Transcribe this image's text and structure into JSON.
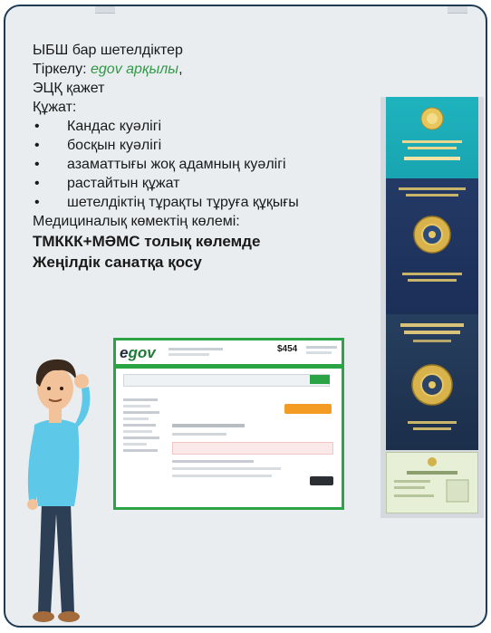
{
  "info": {
    "heading": "ЫБШ бар шетелдіктер",
    "registration_label": "Тіркелу: ",
    "registration_value": "egov арқылы",
    "registration_suffix": ",",
    "ehr_needed": "ЭЦҚ қажет",
    "documents_label": "Құжат:",
    "documents": [
      "Кандас куәлігі",
      "босқын куәлігі",
      "азаматтығы жоқ адамның куәлігі",
      "растайтын құжат",
      "шетелдіктің тұрақты тұруға құқығы"
    ],
    "medical_label": "Медициналық көмектің көлемі:",
    "coverage": "ТМККК+МӘМС толық көлемде",
    "privilege": "Жеңілдік санатқа қосу"
  },
  "egov_screenshot": {
    "logo_e": "e",
    "logo_rest": "gov",
    "price": "$454"
  },
  "colors": {
    "border": "#1f3a53",
    "card_bg": "#e9edf0",
    "egov_green": "#2aa445",
    "accent_green_text": "#2e9a45"
  }
}
